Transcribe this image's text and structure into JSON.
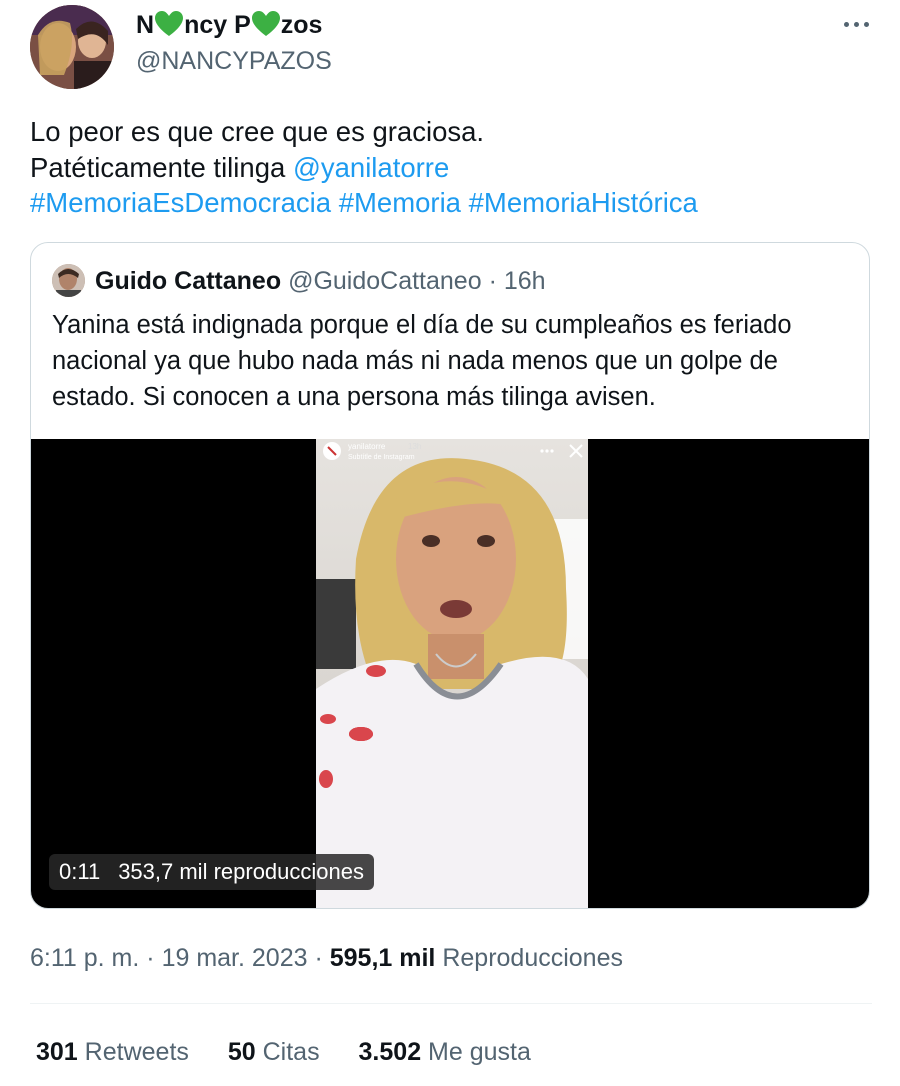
{
  "author": {
    "display_name_parts": [
      "N",
      "ncy P",
      "zos"
    ],
    "heart_emoji": "💚",
    "handle": "@NANCYPAZOS"
  },
  "tweet": {
    "line1": "Lo peor es que cree que es graciosa.",
    "line2_text": "Patéticamente tilinga ",
    "mention": "@yanilatorre",
    "hashtags": [
      "#MemoriaEsDemocracia",
      "#Memoria",
      "#MemoriaHistórica"
    ]
  },
  "quote": {
    "name": "Guido Cattaneo",
    "handle": "@GuidoCattaneo",
    "separator": "·",
    "time": "16h",
    "text": "Yanina está indignada porque el día de su cumpleaños es feriado nacional ya que hubo nada más ni nada menos que un golpe de estado. Si conocen a una persona más tilinga avisen.",
    "video": {
      "duration": "0:11",
      "views": "353,7 mil reproducciones",
      "story_user": "yanilatorre",
      "story_time": "13h",
      "story_sub": "Subtítle de Instagram"
    }
  },
  "meta": {
    "time": "6:11 p. m.",
    "sep": "·",
    "date": "19 mar. 2023",
    "views_count": "595,1 mil",
    "views_label": "Reproducciones"
  },
  "stats": {
    "retweets_count": "301",
    "retweets_label": "Retweets",
    "quotes_count": "50",
    "quotes_label": "Citas",
    "likes_count": "3.502",
    "likes_label": "Me gusta"
  },
  "colors": {
    "link": "#1d9bf0",
    "secondary_text": "#536471",
    "primary_text": "#0f1419",
    "heart": "#3cb043"
  },
  "icons": [
    "more-icon",
    "green-heart-icon",
    "close-icon"
  ]
}
